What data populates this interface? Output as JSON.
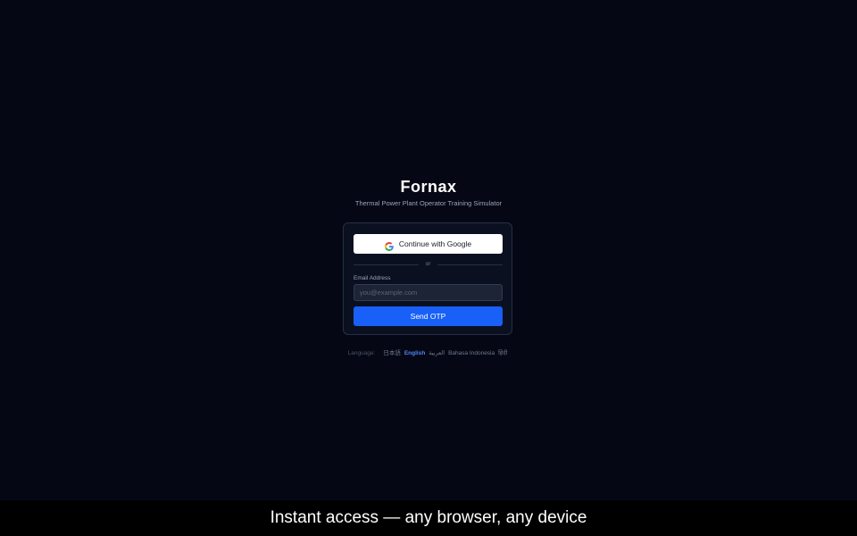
{
  "app": {
    "title": "Fornax",
    "subtitle": "Thermal Power Plant Operator Training Simulator"
  },
  "login": {
    "google_label": "Continue with Google",
    "divider": "or",
    "email_label": "Email Address",
    "email_value": "",
    "email_placeholder": "you@example.com",
    "send_label": "Send OTP"
  },
  "language": {
    "label": "Language:",
    "selected": "English",
    "options": [
      {
        "label": "日本語"
      },
      {
        "label": "English"
      },
      {
        "label": "العربية"
      },
      {
        "label": "Bahasa Indonesia"
      },
      {
        "label": "हिंदी"
      }
    ]
  },
  "caption": "Instant access — any browser, any device",
  "colors": {
    "background": "#050814",
    "card": "#0a1020",
    "primary": "#1860f7",
    "active_language": "#4f86f7"
  },
  "icons": {
    "google": "google-icon"
  }
}
